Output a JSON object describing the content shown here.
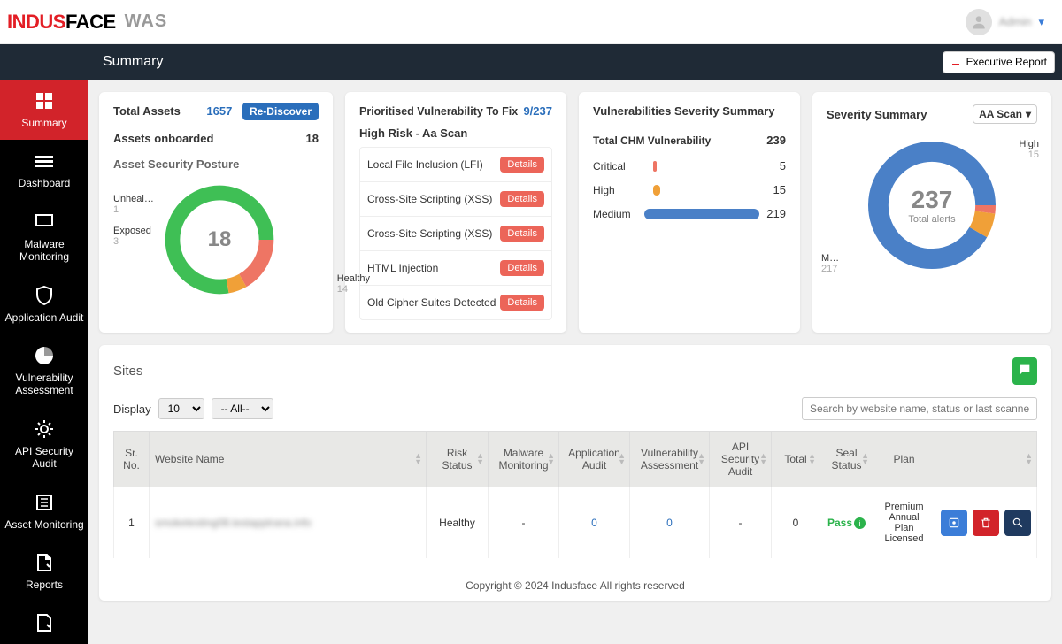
{
  "header": {
    "logo_red": "INDUS",
    "logo_black": "FACE",
    "logo_suffix": "WAS",
    "user_name": "Admin",
    "summary_title": "Summary",
    "exec_report": "Executive Report"
  },
  "sidebar": {
    "items": [
      {
        "label": "Summary"
      },
      {
        "label": "Dashboard"
      },
      {
        "label": "Malware Monitoring"
      },
      {
        "label": "Application Audit"
      },
      {
        "label": "Vulnerability Assessment"
      },
      {
        "label": "API Security Audit"
      },
      {
        "label": "Asset Monitoring"
      },
      {
        "label": "Reports"
      }
    ]
  },
  "assets": {
    "total_label": "Total Assets",
    "total_value": "1657",
    "rediscover": "Re-Discover",
    "onboarded_label": "Assets onboarded",
    "onboarded_value": "18",
    "posture_title": "Asset Security Posture",
    "center": "18",
    "unhealthy_label": "Unheal…",
    "unhealthy_value": "1",
    "exposed_label": "Exposed",
    "exposed_value": "3",
    "healthy_label": "Healthy",
    "healthy_value": "14"
  },
  "priority": {
    "title": "Prioritised Vulnerability To Fix",
    "count": "9/237",
    "subtitle": "High Risk - Aa Scan",
    "details_label": "Details",
    "items": [
      "Local File Inclusion (LFI)",
      "Cross-Site Scripting (XSS)",
      "Cross-Site Scripting (XSS)",
      "HTML Injection",
      "Old Cipher Suites Detected"
    ]
  },
  "vuln_sev": {
    "title": "Vulnerabilities Severity Summary",
    "total_label": "Total CHM Vulnerability",
    "total_value": "239",
    "critical_label": "Critical",
    "critical_value": "5",
    "high_label": "High",
    "high_value": "15",
    "medium_label": "Medium",
    "medium_value": "219"
  },
  "sev_summary": {
    "title": "Severity Summary",
    "scan_select": "AA Scan",
    "center_big": "237",
    "center_small": "Total alerts",
    "high_label": "High",
    "high_value": "15",
    "m_label": "M…",
    "m_value": "217"
  },
  "sites": {
    "title": "Sites",
    "display_label": "Display",
    "display_value": "10",
    "filter_value": "-- All--",
    "search_placeholder": "Search by website name, status or last scanned date",
    "columns": {
      "sr": "Sr. No.",
      "name": "Website Name",
      "risk": "Risk Status",
      "malware": "Malware Monitoring",
      "app": "Application Audit",
      "vuln": "Vulnerability Assessment",
      "api": "API Security Audit",
      "total": "Total",
      "seal": "Seal Status",
      "plan": "Plan"
    },
    "row": {
      "sr": "1",
      "name": "smoketesting08.testapptrana.info",
      "risk": "Healthy",
      "malware": "-",
      "app": "0",
      "vuln": "0",
      "api": "-",
      "total": "0",
      "seal": "Pass",
      "plan": "Premium Annual Plan Licensed"
    }
  },
  "footer": "Copyright © 2024 Indusface All rights reserved",
  "chart_data": [
    {
      "type": "pie",
      "title": "Asset Security Posture",
      "series": [
        {
          "name": "Healthy",
          "value": 14,
          "color": "#3fbf55"
        },
        {
          "name": "Exposed",
          "value": 3,
          "color": "#ee7564"
        },
        {
          "name": "Unhealthy",
          "value": 1,
          "color": "#f0a038"
        }
      ],
      "total": 18
    },
    {
      "type": "bar",
      "title": "Vulnerabilities Severity Summary",
      "categories": [
        "Critical",
        "High",
        "Medium"
      ],
      "values": [
        5,
        15,
        219
      ],
      "colors": [
        "#ee7564",
        "#f0a038",
        "#4a80c7"
      ]
    },
    {
      "type": "pie",
      "title": "Severity Summary",
      "series": [
        {
          "name": "Medium",
          "value": 217,
          "color": "#4a80c7"
        },
        {
          "name": "High",
          "value": 15,
          "color": "#f0a038"
        },
        {
          "name": "Critical",
          "value": 5,
          "color": "#ee7564"
        }
      ],
      "total": 237
    }
  ]
}
